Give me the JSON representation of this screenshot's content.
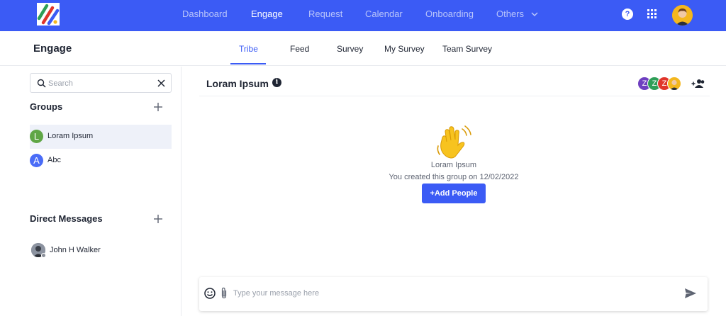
{
  "nav": {
    "items": [
      {
        "label": "Dashboard",
        "active": false
      },
      {
        "label": "Engage",
        "active": true
      },
      {
        "label": "Request",
        "active": false
      },
      {
        "label": "Calendar",
        "active": false
      },
      {
        "label": "Onboarding",
        "active": false
      },
      {
        "label": "Others",
        "active": false
      }
    ],
    "help_label": "?",
    "icons": [
      "apps-grid-icon",
      "user-avatar",
      "chevron-down-icon"
    ]
  },
  "subheader": {
    "title": "Engage",
    "tabs": [
      {
        "label": "Tribe",
        "active": true
      },
      {
        "label": "Feed",
        "active": false
      },
      {
        "label": "Survey",
        "active": false
      },
      {
        "label": "My Survey",
        "active": false
      },
      {
        "label": "Team Survey",
        "active": false
      }
    ]
  },
  "sidebar": {
    "search_placeholder": "Search",
    "groups_heading": "Groups",
    "groups": [
      {
        "initial": "L",
        "name": "Loram Ipsum",
        "color": "#5fa646",
        "selected": true
      },
      {
        "initial": "A",
        "name": "Abc",
        "color": "#4a6cf7",
        "selected": false
      }
    ],
    "dm_heading": "Direct Messages",
    "direct_messages": [
      {
        "name": "John H Walker",
        "status": "offline"
      }
    ]
  },
  "chat": {
    "title": "Loram Ipsum",
    "info_label": "i",
    "members": [
      {
        "initial": "Z",
        "color": "#6e3fc0"
      },
      {
        "initial": "Z",
        "color": "#2e9e57"
      },
      {
        "initial": "Z",
        "color": "#e0352b"
      },
      {
        "initial": "",
        "color": "#f4b71e"
      }
    ],
    "group_name": "Loram Ipsum",
    "created_text": "You created this group on 12/02/2022",
    "add_people_label": "+Add People",
    "composer_placeholder": "Type your message here"
  },
  "colors": {
    "brand": "#3b5bf5",
    "selected_row": "#eef1f9"
  }
}
